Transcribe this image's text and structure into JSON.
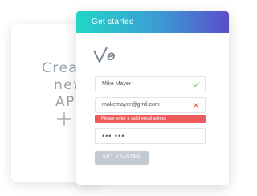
{
  "background_card": {
    "line1": "Create",
    "line2": "new",
    "line3": "API",
    "add_icon": "plus-icon"
  },
  "signup": {
    "title": "Get started",
    "logo_icon": "ve-logo",
    "name_value": "Mike Mayer",
    "email_value": "makemayer@gmil.com",
    "email_error": "Please enter a valid email adress",
    "password_value": "••• •••",
    "submit_label": "GET STARTED",
    "valid_icon": "checkmark-icon",
    "invalid_icon": "x-icon"
  },
  "colors": {
    "header_start": "#22d6c7",
    "header_end": "#5b4ec9",
    "valid": "#7ecf7e",
    "error": "#ef5b5b",
    "button_disabled": "#c3cad2"
  }
}
